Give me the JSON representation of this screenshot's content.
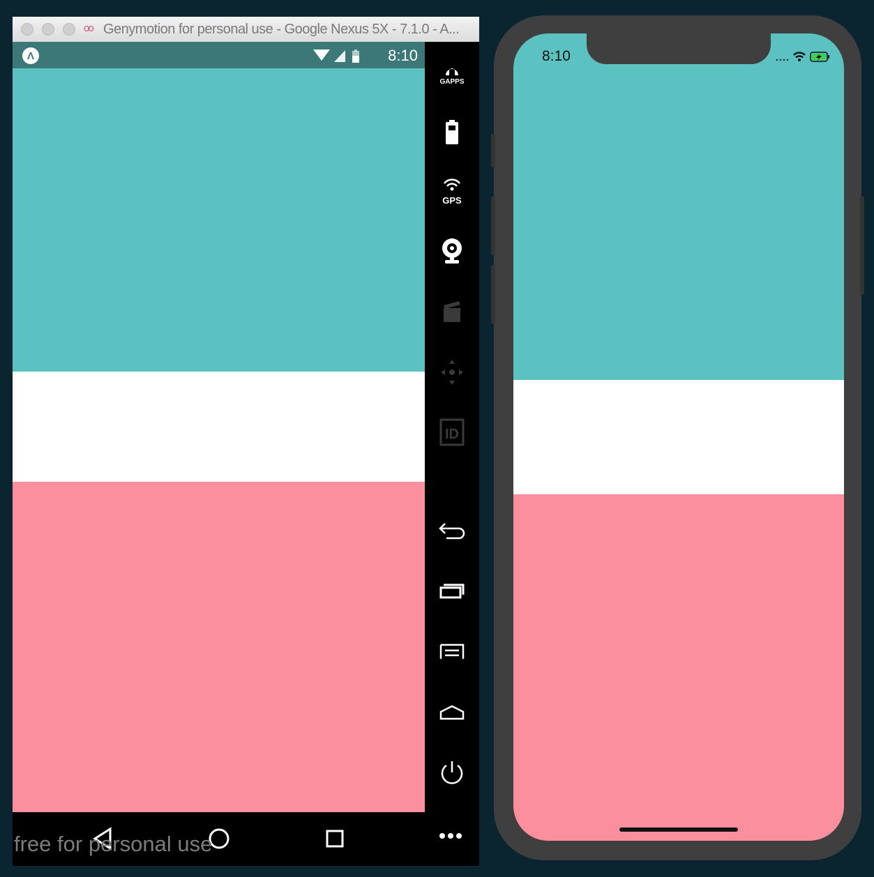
{
  "genymotion": {
    "window_title": "Genymotion for personal use - Google Nexus 5X - 7.1.0 - A...",
    "title_logo": "oo",
    "status_bar": {
      "app_badge": "Λ",
      "time": "8:10"
    },
    "bands": [
      "#5cc2c1",
      "#ffffff",
      "#fc8f9d"
    ],
    "toolbar": [
      {
        "name": "gapps-icon",
        "label": "GAPPS"
      },
      {
        "name": "battery-icon",
        "label": ""
      },
      {
        "name": "gps-icon",
        "label": "GPS"
      },
      {
        "name": "webcam-icon",
        "label": ""
      },
      {
        "name": "capture-icon",
        "label": ""
      },
      {
        "name": "dpad-icon",
        "label": ""
      },
      {
        "name": "device-id-icon",
        "label": "ID"
      },
      {
        "name": "back-icon",
        "label": ""
      },
      {
        "name": "recent-apps-icon",
        "label": ""
      },
      {
        "name": "menu-icon",
        "label": ""
      },
      {
        "name": "home-icon",
        "label": ""
      },
      {
        "name": "power-icon",
        "label": ""
      },
      {
        "name": "more-icon",
        "label": ""
      }
    ],
    "watermark": "free for personal use"
  },
  "iphone": {
    "time": "8:10",
    "bands": [
      "#5cc2c1",
      "#ffffff",
      "#fc8f9d"
    ]
  }
}
